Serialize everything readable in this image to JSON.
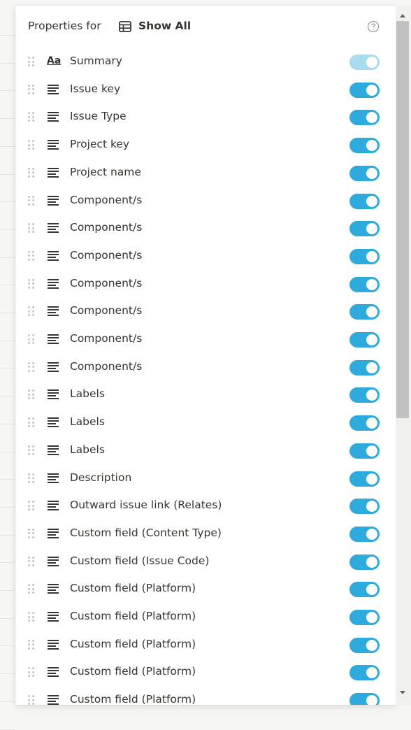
{
  "colors": {
    "toggle_on": "#2eaadc",
    "toggle_disabled": "#a9dcef",
    "text": "#37352f"
  },
  "header": {
    "label": "Properties for",
    "database_icon": "table-icon",
    "database_name": "Show All",
    "help_icon": "help-circle-icon"
  },
  "properties": [
    {
      "icon": "title-aa-icon",
      "name": "Summary",
      "enabled": true,
      "locked": true
    },
    {
      "icon": "text-lines-icon",
      "name": "Issue key",
      "enabled": true
    },
    {
      "icon": "text-lines-icon",
      "name": "Issue Type",
      "enabled": true
    },
    {
      "icon": "text-lines-icon",
      "name": "Project key",
      "enabled": true
    },
    {
      "icon": "text-lines-icon",
      "name": "Project name",
      "enabled": true
    },
    {
      "icon": "text-lines-icon",
      "name": "Component/s",
      "enabled": true
    },
    {
      "icon": "text-lines-icon",
      "name": "Component/s",
      "enabled": true
    },
    {
      "icon": "text-lines-icon",
      "name": "Component/s",
      "enabled": true
    },
    {
      "icon": "text-lines-icon",
      "name": "Component/s",
      "enabled": true
    },
    {
      "icon": "text-lines-icon",
      "name": "Component/s",
      "enabled": true
    },
    {
      "icon": "text-lines-icon",
      "name": "Component/s",
      "enabled": true
    },
    {
      "icon": "text-lines-icon",
      "name": "Component/s",
      "enabled": true
    },
    {
      "icon": "text-lines-icon",
      "name": "Labels",
      "enabled": true
    },
    {
      "icon": "text-lines-icon",
      "name": "Labels",
      "enabled": true
    },
    {
      "icon": "text-lines-icon",
      "name": "Labels",
      "enabled": true
    },
    {
      "icon": "text-lines-icon",
      "name": "Description",
      "enabled": true
    },
    {
      "icon": "text-lines-icon",
      "name": "Outward issue link (Relates)",
      "enabled": true
    },
    {
      "icon": "text-lines-icon",
      "name": "Custom field (Content Type)",
      "enabled": true
    },
    {
      "icon": "text-lines-icon",
      "name": "Custom field (Issue Code)",
      "enabled": true
    },
    {
      "icon": "text-lines-icon",
      "name": "Custom field (Platform)",
      "enabled": true
    },
    {
      "icon": "text-lines-icon",
      "name": "Custom field (Platform)",
      "enabled": true
    },
    {
      "icon": "text-lines-icon",
      "name": "Custom field (Platform)",
      "enabled": true
    },
    {
      "icon": "text-lines-icon",
      "name": "Custom field (Platform)",
      "enabled": true
    },
    {
      "icon": "text-lines-icon",
      "name": "Custom field (Platform)",
      "enabled": true
    }
  ]
}
